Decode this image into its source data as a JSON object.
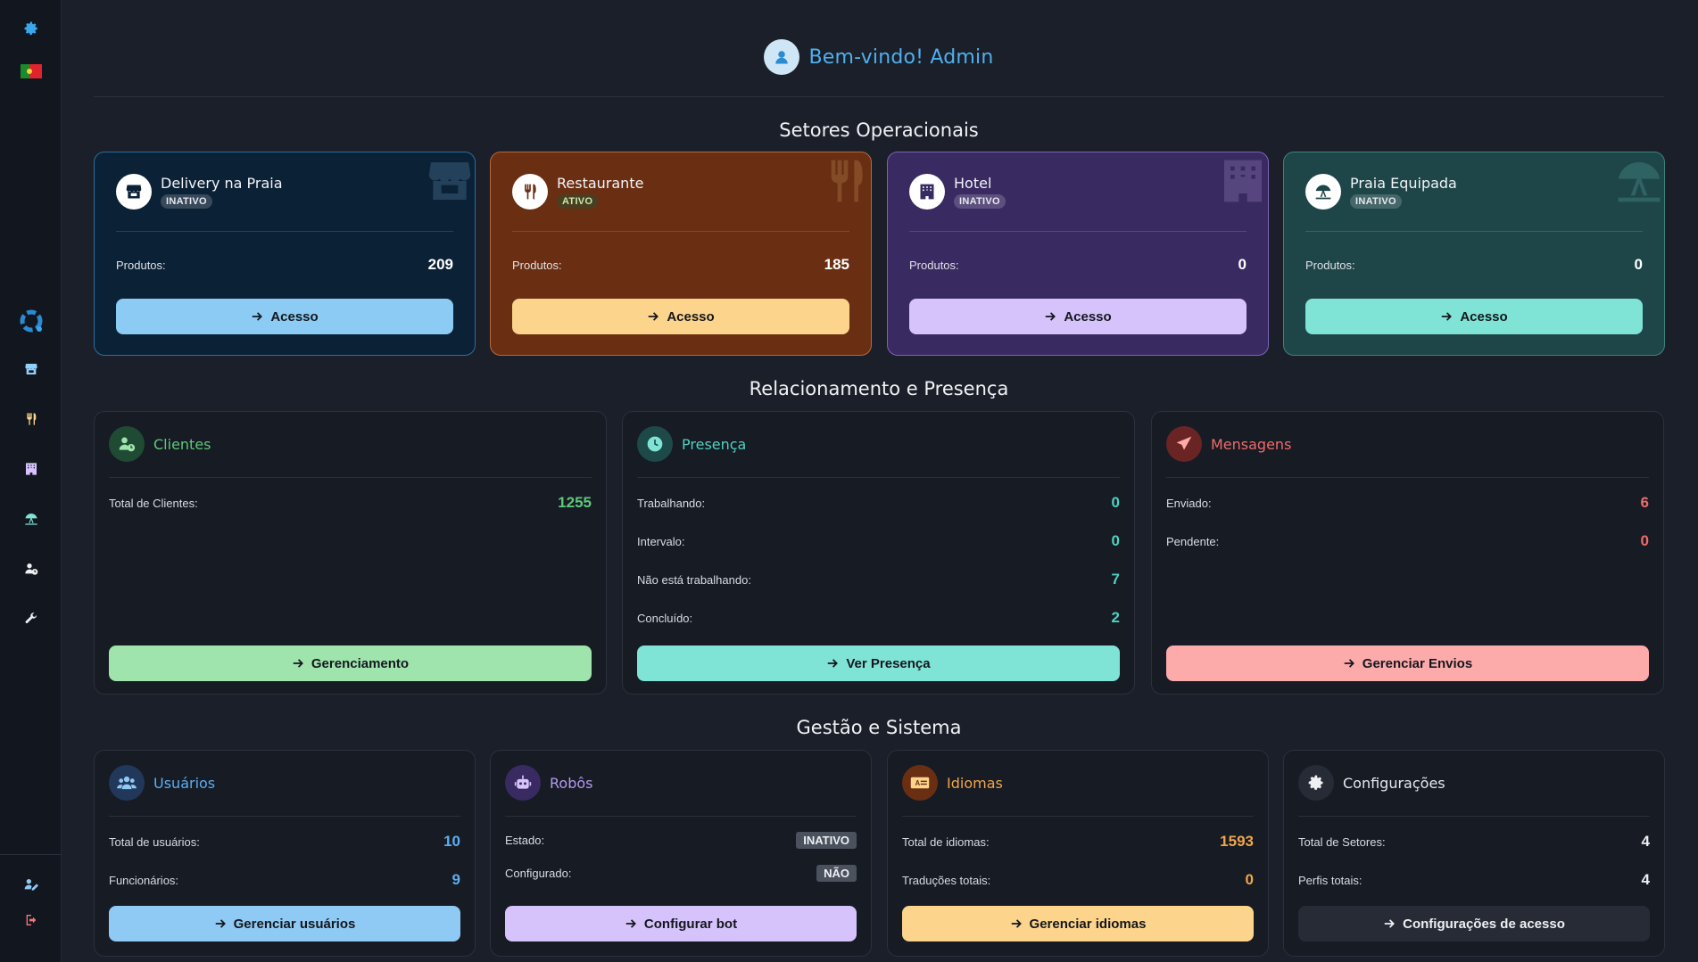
{
  "sidebar": {
    "settings_icon": "gear-icon",
    "language_flag": "portugal-flag-icon",
    "items": [
      {
        "name": "sidebar-item-logo",
        "icon": "spinner-logo-icon"
      },
      {
        "name": "sidebar-item-delivery",
        "icon": "store-icon"
      },
      {
        "name": "sidebar-item-restaurant",
        "icon": "utensils-icon"
      },
      {
        "name": "sidebar-item-hotel",
        "icon": "hotel-icon"
      },
      {
        "name": "sidebar-item-beach",
        "icon": "umbrella-beach-icon"
      },
      {
        "name": "sidebar-item-clients",
        "icon": "user-clock-icon"
      },
      {
        "name": "sidebar-item-tools",
        "icon": "wrench-icon"
      },
      {
        "name": "sidebar-item-profile",
        "icon": "user-edit-icon"
      },
      {
        "name": "sidebar-item-logout",
        "icon": "logout-icon"
      }
    ]
  },
  "header": {
    "welcome": "Bem-vindo! Admin"
  },
  "sections": {
    "sectors_title": "Setores Operacionais",
    "relations_title": "Relacionamento e Presença",
    "management_title": "Gestão e Sistema"
  },
  "sectors": [
    {
      "name": "Delivery na Praia",
      "status": "INATIVO",
      "products_label": "Produtos:",
      "products": "209",
      "button": "Acesso",
      "colors": {
        "bg": "#0b2136",
        "border": "#2b6f9f",
        "button": "#8ccbf3"
      }
    },
    {
      "name": "Restaurante",
      "status": "ATIVO",
      "products_label": "Produtos:",
      "products": "185",
      "button": "Acesso",
      "colors": {
        "bg": "#6a2e12",
        "border": "#b8693f",
        "button": "#fdd48b"
      }
    },
    {
      "name": "Hotel",
      "status": "INATIVO",
      "products_label": "Produtos:",
      "products": "0",
      "button": "Acesso",
      "colors": {
        "bg": "#3a2a62",
        "border": "#7a64b8",
        "button": "#d6c3fb"
      }
    },
    {
      "name": "Praia Equipada",
      "status": "INATIVO",
      "products_label": "Produtos:",
      "products": "0",
      "button": "Acesso",
      "colors": {
        "bg": "#1e4648",
        "border": "#3d8381",
        "button": "#7fe3d6"
      }
    }
  ],
  "relations": {
    "clients": {
      "title": "Clientes",
      "total_label": "Total de Clientes:",
      "total": "1255",
      "button": "Gerenciamento",
      "color": "#5ec87a",
      "button_color": "#9fe4ad"
    },
    "presence": {
      "title": "Presença",
      "working_label": "Trabalhando:",
      "working": "0",
      "break_label": "Intervalo:",
      "break": "0",
      "not_working_label": "Não está trabalhando:",
      "not_working": "7",
      "done_label": "Concluído:",
      "done": "2",
      "button": "Ver Presença",
      "color": "#4fd1c0",
      "button_color": "#7fe3d6"
    },
    "messages": {
      "title": "Mensagens",
      "sent_label": "Enviado:",
      "sent": "6",
      "pending_label": "Pendente:",
      "pending": "0",
      "button": "Gerenciar Envios",
      "color": "#f06b6b",
      "button_color": "#fdaaaa"
    }
  },
  "management": {
    "users": {
      "title": "Usuários",
      "total_label": "Total de usuários:",
      "total": "10",
      "employees_label": "Funcionários:",
      "employees": "9",
      "button": "Gerenciar usuários",
      "color": "#5eaef0",
      "button_color": "#8fcaf4"
    },
    "robots": {
      "title": "Robôs",
      "state_label": "Estado:",
      "state": "INATIVO",
      "configured_label": "Configurado:",
      "configured": "NÃO",
      "button": "Configurar bot",
      "color": "#b59af0",
      "button_color": "#d6c3fb"
    },
    "languages": {
      "title": "Idiomas",
      "total_label": "Total de idiomas:",
      "total": "1593",
      "translations_label": "Traduções totais:",
      "translations": "0",
      "button": "Gerenciar idiomas",
      "color": "#f2a54a",
      "button_color": "#fdd48b"
    },
    "settings": {
      "title": "Configurações",
      "sectors_label": "Total de Setores:",
      "sectors": "4",
      "profiles_label": "Perfis totais:",
      "profiles": "4",
      "button": "Configurações de acesso",
      "color": "#e6e8ee",
      "button_color": "#262b35"
    }
  }
}
